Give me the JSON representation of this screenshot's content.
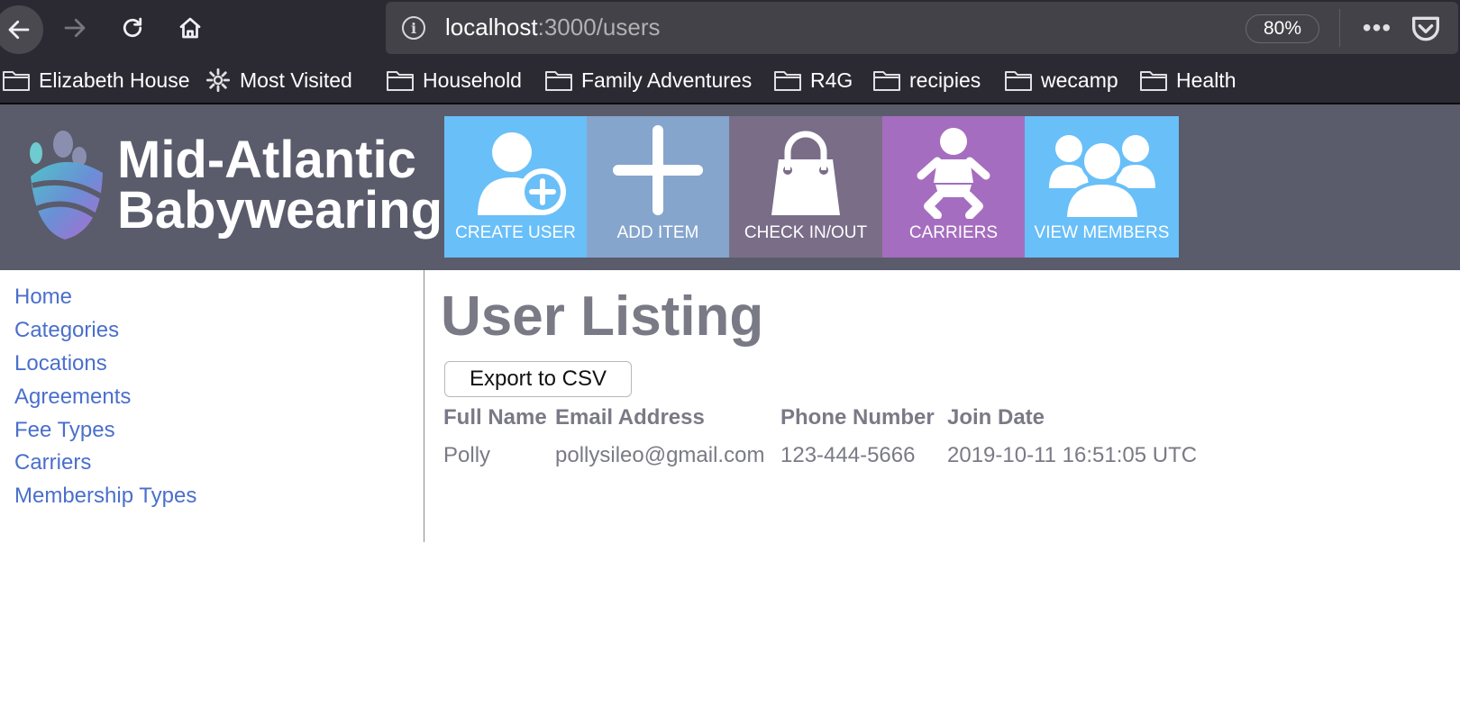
{
  "browser": {
    "url_host": "localhost",
    "url_path": ":3000/users",
    "zoom": "80%",
    "more": "•••",
    "info_glyph": "i"
  },
  "bookmarks": [
    {
      "label": "Elizabeth House",
      "icon": "folder-icon"
    },
    {
      "label": "Most Visited",
      "icon": "gear-icon"
    },
    {
      "label": "Household",
      "icon": "folder-icon"
    },
    {
      "label": "Family Adventures",
      "icon": "folder-icon"
    },
    {
      "label": "R4G",
      "icon": "folder-icon"
    },
    {
      "label": "recipies",
      "icon": "folder-icon"
    },
    {
      "label": "wecamp",
      "icon": "folder-icon"
    },
    {
      "label": "Health",
      "icon": "folder-icon"
    }
  ],
  "header": {
    "logo_line1": "Mid-Atlantic",
    "logo_line2": "Babywearing",
    "tiles": [
      {
        "label": "CREATE USER",
        "icon": "add-user-icon",
        "color": "#69bff8"
      },
      {
        "label": "ADD ITEM",
        "icon": "plus-icon",
        "color": "#85a5cd"
      },
      {
        "label": "CHECK IN/OUT",
        "icon": "bag-icon",
        "color": "#7a6d88"
      },
      {
        "label": "CARRIERS",
        "icon": "baby-icon",
        "color": "#a56dbf"
      },
      {
        "label": "VIEW MEMBERS",
        "icon": "members-icon",
        "color": "#69bff8"
      }
    ]
  },
  "sidebar": {
    "items": [
      {
        "label": "Home"
      },
      {
        "label": "Categories"
      },
      {
        "label": "Locations"
      },
      {
        "label": "Agreements"
      },
      {
        "label": "Fee Types"
      },
      {
        "label": "Carriers"
      },
      {
        "label": "Membership Types"
      }
    ]
  },
  "main": {
    "title": "User Listing",
    "export_label": "Export to CSV",
    "columns": [
      "Full Name",
      "Email Address",
      "Phone Number",
      "Join Date"
    ],
    "rows": [
      [
        "Polly",
        "pollysileo@gmail.com",
        "123-444-5666",
        "2019-10-11 16:51:05 UTC"
      ]
    ]
  },
  "colors": {
    "link": "#4a6fcc",
    "header_bg": "#5a5b6b",
    "text_muted": "#7a7a86"
  }
}
